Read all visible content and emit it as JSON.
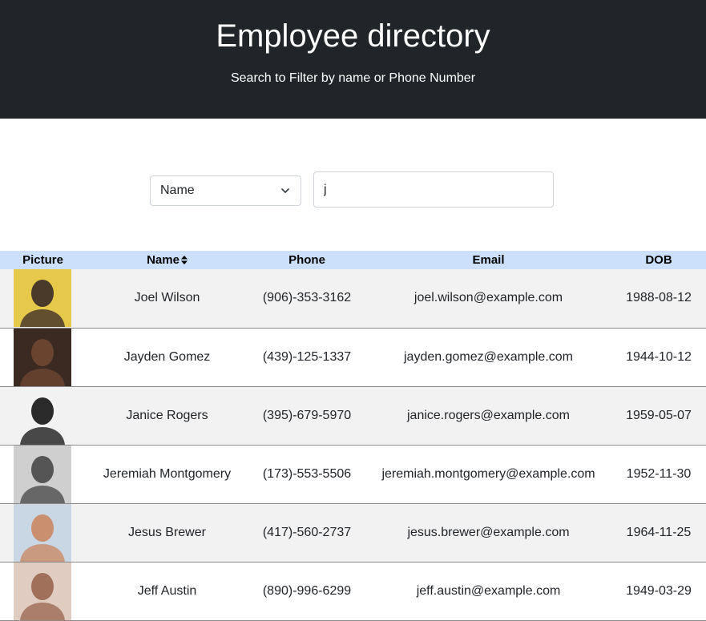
{
  "header": {
    "title": "Employee directory",
    "subtitle": "Search to Filter by name or Phone Number"
  },
  "search": {
    "filter_selected": "Name",
    "query_value": "j"
  },
  "table": {
    "columns": [
      "Picture",
      "Name",
      "Phone",
      "Email",
      "DOB"
    ],
    "rows": [
      {
        "name": "Joel Wilson",
        "phone": "(906)-353-3162",
        "email": "joel.wilson@example.com",
        "dob": "1988-08-12",
        "avatar_bg": "#e6c94a",
        "avatar_fg": "#4a3a2a"
      },
      {
        "name": "Jayden Gomez",
        "phone": "(439)-125-1337",
        "email": "jayden.gomez@example.com",
        "dob": "1944-10-12",
        "avatar_bg": "#3a2a22",
        "avatar_fg": "#6b4430"
      },
      {
        "name": "Janice Rogers",
        "phone": "(395)-679-5970",
        "email": "janice.rogers@example.com",
        "dob": "1959-05-07",
        "avatar_bg": "#f2f2f2",
        "avatar_fg": "#2a2a2a"
      },
      {
        "name": "Jeremiah Montgomery",
        "phone": "(173)-553-5506",
        "email": "jeremiah.montgomery@example.com",
        "dob": "1952-11-30",
        "avatar_bg": "#cfcfcf",
        "avatar_fg": "#555555"
      },
      {
        "name": "Jesus Brewer",
        "phone": "(417)-560-2737",
        "email": "jesus.brewer@example.com",
        "dob": "1964-11-25",
        "avatar_bg": "#c9d6e3",
        "avatar_fg": "#c98f6e"
      },
      {
        "name": "Jeff Austin",
        "phone": "(890)-996-6299",
        "email": "jeff.austin@example.com",
        "dob": "1949-03-29",
        "avatar_bg": "#e0ccc0",
        "avatar_fg": "#a0705a"
      }
    ]
  },
  "colors": {
    "header_bg": "#212529",
    "table_header_bg": "#cce0fc",
    "row_stripe": "#f2f2f2"
  }
}
